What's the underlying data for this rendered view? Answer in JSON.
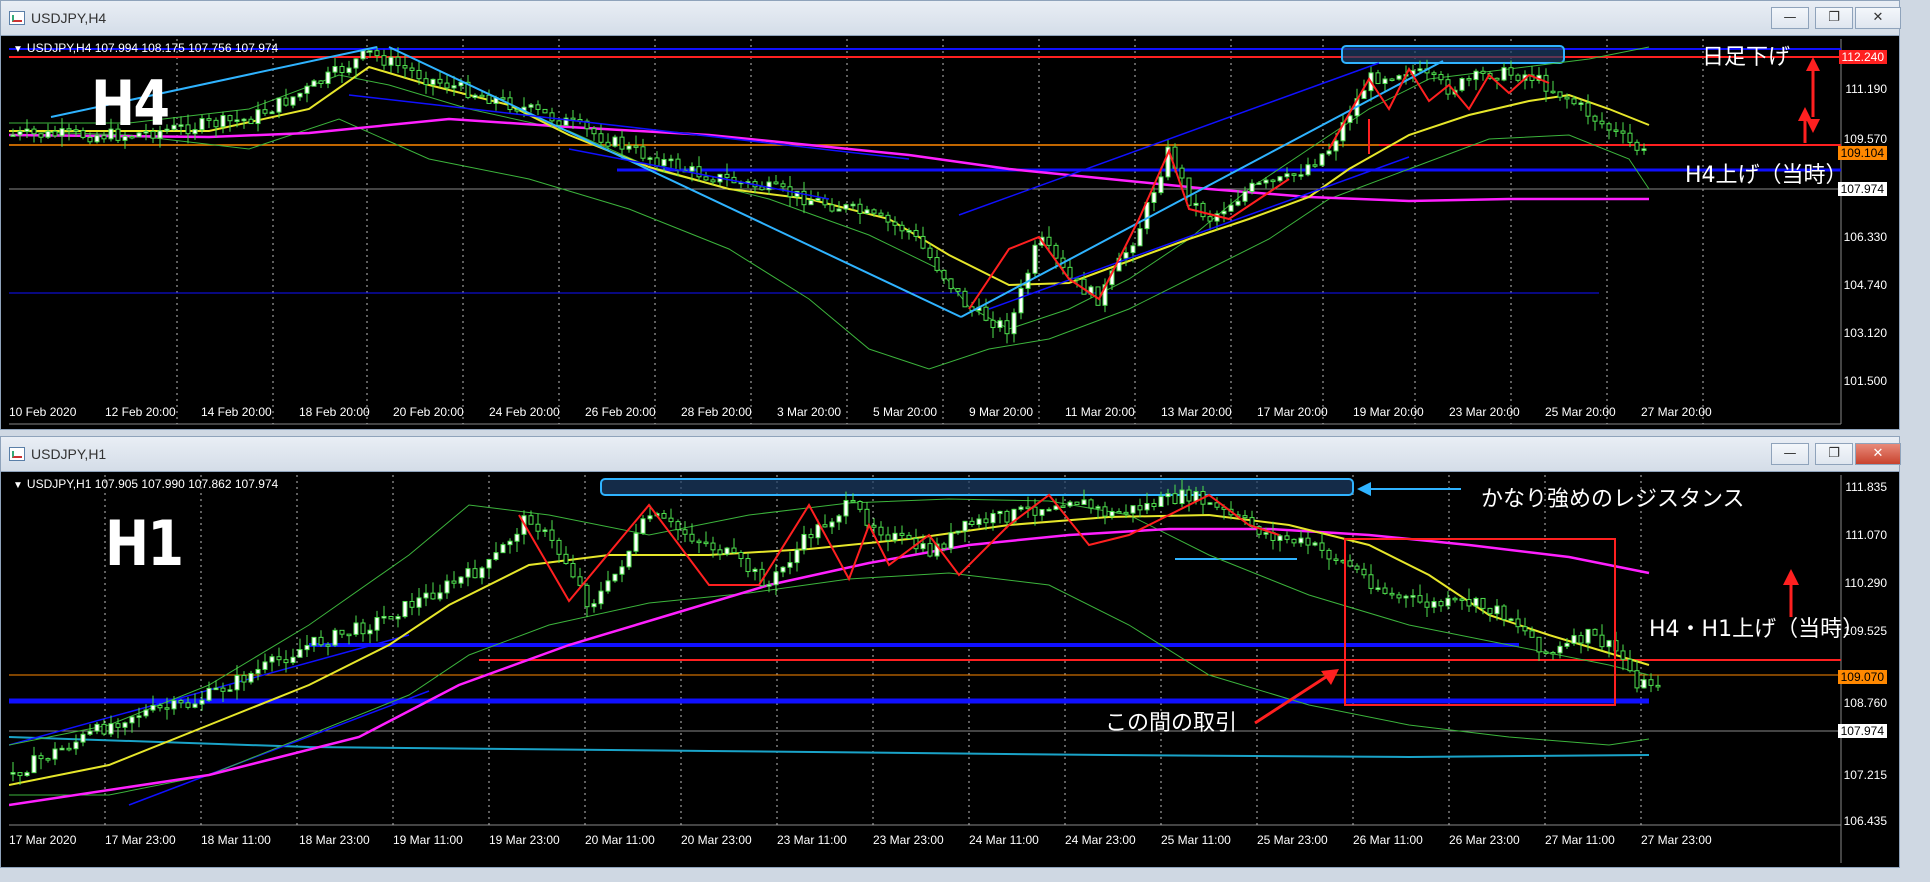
{
  "windows": [
    {
      "id": "h4",
      "title": "USDJPY,H4",
      "header": "USDJPY,H4  107.994 108.175 107.756 107.974",
      "big_label": "H4",
      "price_labels": [
        {
          "text": "112.240",
          "kind": "red"
        },
        {
          "text": "111.190",
          "kind": "plain"
        },
        {
          "text": "109.570",
          "kind": "plain"
        },
        {
          "text": "109.104",
          "kind": "orange"
        },
        {
          "text": "107.974",
          "kind": "white"
        },
        {
          "text": "106.330",
          "kind": "plain"
        },
        {
          "text": "104.740",
          "kind": "plain"
        },
        {
          "text": "103.120",
          "kind": "plain"
        },
        {
          "text": "101.500",
          "kind": "plain"
        }
      ],
      "time_labels": [
        "10 Feb 2020",
        "12 Feb 20:00",
        "14 Feb 20:00",
        "18 Feb 20:00",
        "20 Feb 20:00",
        "24 Feb 20:00",
        "26 Feb 20:00",
        "28 Feb 20:00",
        "3 Mar 20:00",
        "5 Mar 20:00",
        "9 Mar 20:00",
        "11 Mar 20:00",
        "13 Mar 20:00",
        "17 Mar 20:00",
        "19 Mar 20:00",
        "23 Mar 20:00",
        "25 Mar 20:00",
        "27 Mar 20:00"
      ],
      "notes": [
        "日足下げ",
        "H4上げ（当時）"
      ]
    },
    {
      "id": "h1",
      "title": "USDJPY,H1",
      "header": "USDJPY,H1  107.905 107.990 107.862 107.974",
      "big_label": "H1",
      "price_labels": [
        {
          "text": "111.835",
          "kind": "plain"
        },
        {
          "text": "111.070",
          "kind": "plain"
        },
        {
          "text": "110.290",
          "kind": "plain"
        },
        {
          "text": "109.525",
          "kind": "plain"
        },
        {
          "text": "109.070",
          "kind": "orange"
        },
        {
          "text": "108.760",
          "kind": "plain"
        },
        {
          "text": "107.974",
          "kind": "white"
        },
        {
          "text": "107.215",
          "kind": "plain"
        },
        {
          "text": "106.435",
          "kind": "plain"
        }
      ],
      "time_labels": [
        "17 Mar 2020",
        "17 Mar 23:00",
        "18 Mar 11:00",
        "18 Mar 23:00",
        "19 Mar 11:00",
        "19 Mar 23:00",
        "20 Mar 11:00",
        "20 Mar 23:00",
        "23 Mar 11:00",
        "23 Mar 23:00",
        "24 Mar 11:00",
        "24 Mar 23:00",
        "25 Mar 11:00",
        "25 Mar 23:00",
        "26 Mar 11:00",
        "26 Mar 23:00",
        "27 Mar 11:00",
        "27 Mar 23:00"
      ],
      "notes": [
        "かなり強めのレジスタンス",
        "H4・H1上げ（当時）",
        "この間の取引"
      ]
    }
  ],
  "colors": {
    "background": "#000000",
    "red_line": "#ff2020",
    "blue_line": "#1010ff",
    "cyan_line": "#2fb3ff",
    "yellow_ma": "#e6e62a",
    "magenta_ma": "#ff20ff",
    "orange_line": "#ff8800"
  }
}
